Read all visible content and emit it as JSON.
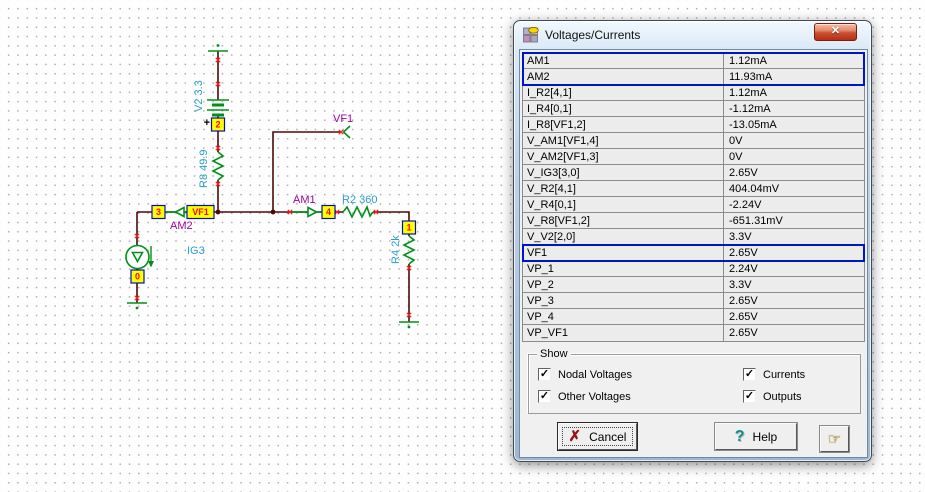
{
  "schematic": {
    "components": [
      {
        "ref": "V2",
        "type": "battery",
        "label": "V2 3.3"
      },
      {
        "ref": "R8",
        "type": "resistor",
        "label": "R8 49.9"
      },
      {
        "ref": "R2",
        "type": "resistor",
        "label": "R2 360"
      },
      {
        "ref": "R4",
        "type": "resistor",
        "label": "R4 2k"
      },
      {
        "ref": "IG3",
        "type": "current-source",
        "label": "IG3"
      },
      {
        "ref": "AM1",
        "type": "ammeter",
        "label": "AM1"
      },
      {
        "ref": "AM2",
        "type": "ammeter",
        "label": "AM2"
      },
      {
        "ref": "VF1",
        "type": "voltage-probe",
        "label": "VF1"
      }
    ],
    "battery_plus": "+",
    "nodes": {
      "n0": "0",
      "n1": "1",
      "n2": "2",
      "n3": "3",
      "n4": "4",
      "vf1": "VF1"
    },
    "colors": {
      "wire": "#4E0808",
      "component": "#009018",
      "pin_mark": "#FF2020",
      "node_fill": "#FFFF00",
      "node_border": "#0012B4",
      "node_text": "#FF0000",
      "value_label": "#2AA0C8",
      "meter_label": "#A000A0"
    }
  },
  "dialog": {
    "title": "Voltages/Currents",
    "close_icon": "✕",
    "highlight_color": "#0014C8",
    "rows": [
      {
        "name": "AM1",
        "value": "1.12mA"
      },
      {
        "name": "AM2",
        "value": "11.93mA"
      },
      {
        "name": "I_R2[4,1]",
        "value": "1.12mA"
      },
      {
        "name": "I_R4[0,1]",
        "value": "-1.12mA"
      },
      {
        "name": "I_R8[VF1,2]",
        "value": "-13.05mA"
      },
      {
        "name": "V_AM1[VF1,4]",
        "value": "0V"
      },
      {
        "name": "V_AM2[VF1,3]",
        "value": "0V"
      },
      {
        "name": "V_IG3[3,0]",
        "value": "2.65V"
      },
      {
        "name": "V_R2[4,1]",
        "value": "404.04mV"
      },
      {
        "name": "V_R4[0,1]",
        "value": "-2.24V"
      },
      {
        "name": "V_R8[VF1,2]",
        "value": "-651.31mV"
      },
      {
        "name": "V_V2[2,0]",
        "value": "3.3V"
      },
      {
        "name": "VF1",
        "value": "2.65V"
      },
      {
        "name": "VP_1",
        "value": "2.24V"
      },
      {
        "name": "VP_2",
        "value": "3.3V"
      },
      {
        "name": "VP_3",
        "value": "2.65V"
      },
      {
        "name": "VP_4",
        "value": "2.65V"
      },
      {
        "name": "VP_VF1",
        "value": "2.65V"
      }
    ],
    "check_glyph": "✓",
    "show_group": {
      "label": "Show",
      "items": [
        {
          "label": "Nodal Voltages",
          "checked": true
        },
        {
          "label": "Other Voltages",
          "checked": true
        },
        {
          "label": "Currents",
          "checked": true
        },
        {
          "label": "Outputs",
          "checked": true
        }
      ]
    },
    "buttons": {
      "cancel": {
        "label": "Cancel",
        "icon": "✗"
      },
      "help": {
        "label": "Help",
        "icon": "?"
      },
      "hand": {
        "icon": "☞"
      }
    }
  }
}
